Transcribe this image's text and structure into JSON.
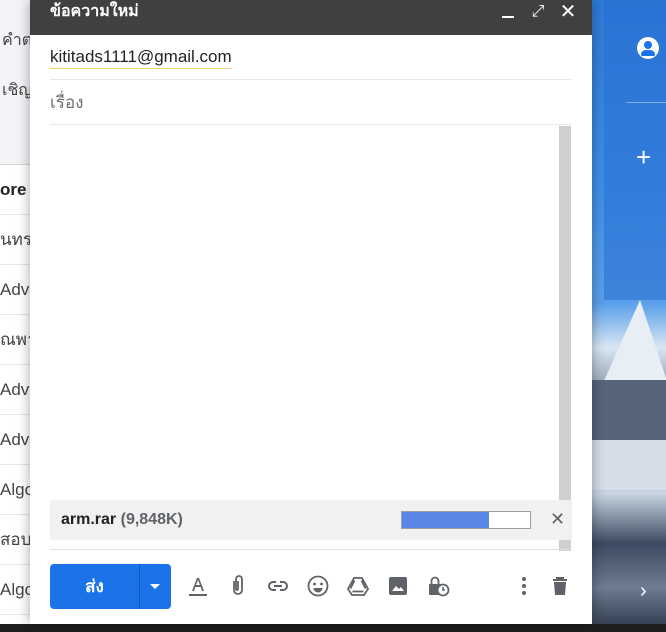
{
  "background_list": {
    "top_items": [
      "คำต",
      "เชิญ"
    ],
    "rows": [
      {
        "text": "ore -",
        "bold": true
      },
      {
        "text": "นทรา",
        "bold": false
      },
      {
        "text": "Adva",
        "bold": false
      },
      {
        "text": "ณพา",
        "bold": false
      },
      {
        "text": "Adva",
        "bold": false
      },
      {
        "text": "Adva",
        "bold": false
      },
      {
        "text": "Algo",
        "bold": false
      },
      {
        "text": "สอบถ",
        "bold": false
      },
      {
        "text": "Algor",
        "bold": false
      }
    ]
  },
  "compose": {
    "title": "ข้อความใหม่",
    "to": "kititads1111@gmail.com",
    "subject_placeholder": "เรื่อง",
    "attachment": {
      "name": "arm.rar",
      "size": "(9,848K)",
      "progress": 0.68
    },
    "send_label": "ส่ง"
  },
  "icons": {
    "minimize": "minimize-icon",
    "expand": "expand-icon",
    "close": "close-icon",
    "formatting": "format-text-icon",
    "attach": "attach-file-icon",
    "link": "insert-link-icon",
    "emoji": "emoji-icon",
    "drive": "google-drive-icon",
    "photo": "insert-photo-icon",
    "confidential": "confidential-mode-icon",
    "more": "more-options-icon",
    "delete": "delete-icon"
  },
  "colors": {
    "send_button": "#1a73e8",
    "header": "#404040",
    "progress_fill": "#5b86e5"
  }
}
